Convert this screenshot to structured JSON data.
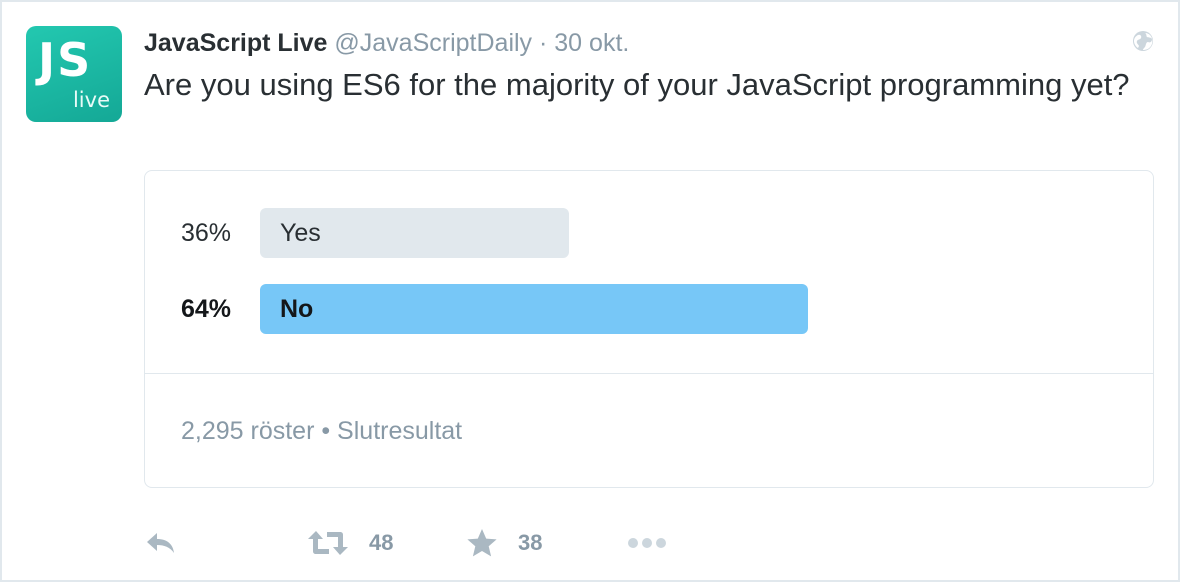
{
  "tweet": {
    "avatar": {
      "top_text": "JS",
      "bottom_text": "live",
      "colors": [
        "#23c8b0",
        "#14a896"
      ]
    },
    "author_name": "JavaScript Live",
    "handle": "@JavaScriptDaily",
    "separator": "·",
    "date": "30 okt.",
    "privacy_icon": "globe-icon",
    "text": "Are you using ES6 for the majority of your JavaScript programming yet?"
  },
  "poll": {
    "options": [
      {
        "percent_label": "36%",
        "label": "Yes",
        "percent": 36,
        "winner": false,
        "bar_color": "#e1e8ed"
      },
      {
        "percent_label": "64%",
        "label": "No",
        "percent": 64,
        "winner": true,
        "bar_color": "#77c7f7"
      }
    ],
    "footer": "2,295 röster • Slutresultat"
  },
  "actions": {
    "reply": {
      "icon": "reply-icon"
    },
    "retweet": {
      "icon": "retweet-icon",
      "count": "48"
    },
    "like": {
      "icon": "star-icon",
      "count": "38"
    },
    "more": {
      "icon": "more-icon"
    }
  },
  "colors": {
    "text": "#292f33",
    "muted": "#8899a6",
    "border": "#e1e8ed",
    "winner_bar": "#77c7f7",
    "loser_bar": "#e1e8ed",
    "action_icon": "#aab8c2"
  }
}
